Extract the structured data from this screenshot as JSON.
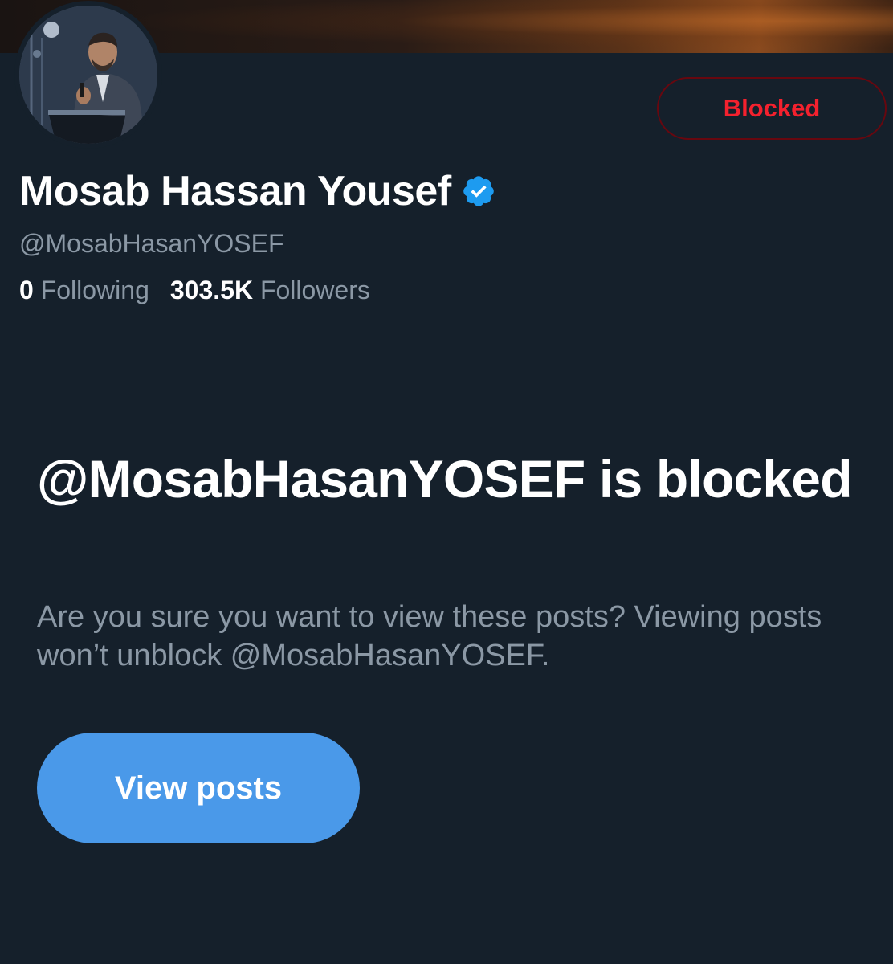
{
  "profile": {
    "display_name": "Mosab Hassan Yousef",
    "handle": "@MosabHasanYOSEF",
    "verified": true,
    "verified_icon": "verified-badge-icon",
    "following_count": "0",
    "following_label": "Following",
    "followers_count": "303.5K",
    "followers_label": "Followers"
  },
  "actions": {
    "blocked_label": "Blocked"
  },
  "blocked_notice": {
    "title": "@MosabHasanYOSEF is blocked",
    "description": "Are you sure you want to view these posts? Viewing posts won’t unblock @MosabHasanYOSEF.",
    "view_posts_label": "View posts"
  },
  "colors": {
    "background": "#15202b",
    "accent_blue": "#4a99e9",
    "blocked_red": "#f4212e",
    "blocked_border": "#67070f",
    "secondary_text": "#8b98a5"
  }
}
